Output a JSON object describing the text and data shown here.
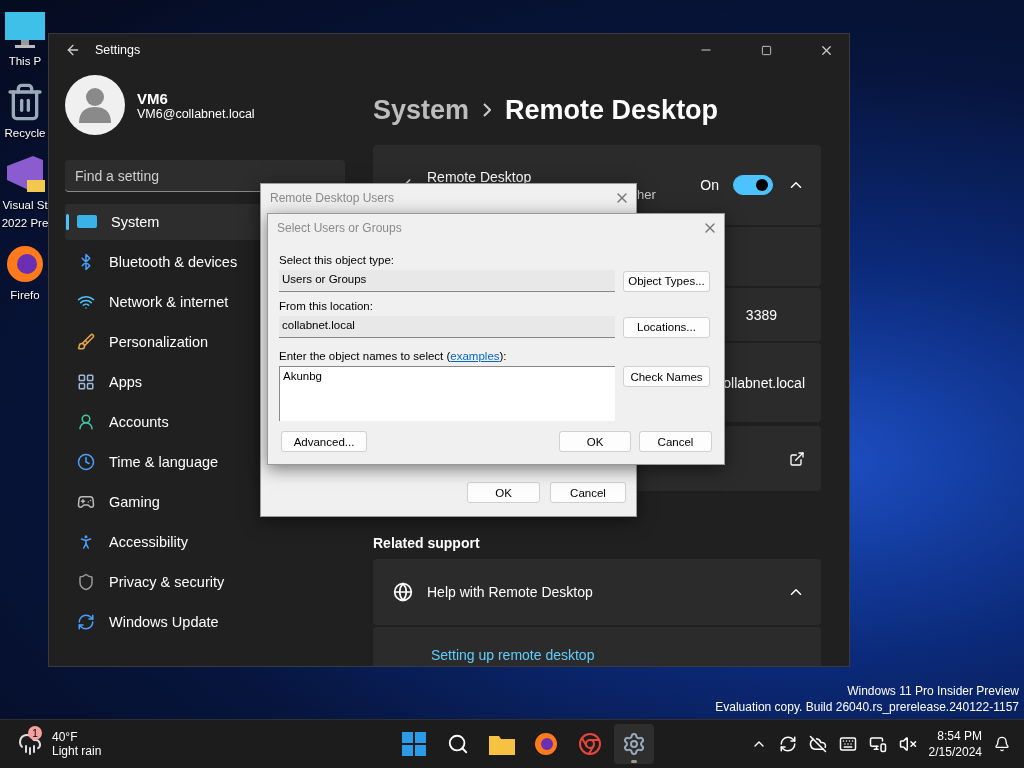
{
  "desktop_icons": [
    {
      "kind": "pc",
      "lines": [
        "This P"
      ]
    },
    {
      "kind": "bin",
      "lines": [
        "Recycle"
      ]
    },
    {
      "kind": "vs",
      "lines": [
        "Visual St",
        "2022 Pre"
      ]
    },
    {
      "kind": "firefox",
      "lines": [
        "Firefo"
      ]
    }
  ],
  "settings": {
    "title": "Settings",
    "user": {
      "name": "VM6",
      "email": "VM6@collabnet.local"
    },
    "search": {
      "placeholder": "Find a setting"
    },
    "nav": [
      {
        "label": "System",
        "selected": true
      },
      {
        "label": "Bluetooth & devices",
        "selected": false
      },
      {
        "label": "Network & internet",
        "selected": false
      },
      {
        "label": "Personalization",
        "selected": false
      },
      {
        "label": "Apps",
        "selected": false
      },
      {
        "label": "Accounts",
        "selected": false
      },
      {
        "label": "Time & language",
        "selected": false
      },
      {
        "label": "Gaming",
        "selected": false
      },
      {
        "label": "Accessibility",
        "selected": false
      },
      {
        "label": "Privacy & security",
        "selected": false
      },
      {
        "label": "Windows Update",
        "selected": false
      }
    ],
    "breadcrumb": [
      "System",
      "Remote Desktop"
    ],
    "remote_desktop": {
      "title": "Remote Desktop",
      "description_fragment": "her",
      "state_label": "On",
      "on": true,
      "expanded": true
    },
    "port": "3389",
    "pc_name_fragment": "ollabnet.local",
    "related_support": {
      "heading": "Related support",
      "help_title": "Help with Remote Desktop",
      "expanded": true,
      "link": "Setting up remote desktop"
    }
  },
  "rdu_dialog": {
    "title": "Remote Desktop Users",
    "ok": "OK",
    "cancel": "Cancel"
  },
  "select_dialog": {
    "title": "Select Users or Groups",
    "object_type": {
      "label": "Select this object type:",
      "value": "Users or Groups",
      "button": "Object Types..."
    },
    "location": {
      "label": "From this location:",
      "value": "collabnet.local",
      "button": "Locations..."
    },
    "names": {
      "label": "Enter the object names to select (",
      "link": "examples",
      "label_end": "):",
      "value": "Akunbg",
      "button": "Check Names"
    },
    "advanced": "Advanced...",
    "ok": "OK",
    "cancel": "Cancel"
  },
  "watermark": [
    "Windows 11 Pro Insider Preview",
    "Evaluation copy. Build 26040.rs_prerelease.240122-1157"
  ],
  "taskbar": {
    "weather": {
      "temp": "40°F",
      "condition": "Light rain",
      "badge": "1"
    },
    "apps": [
      {
        "kind": "start",
        "active": false
      },
      {
        "kind": "search",
        "active": false
      },
      {
        "kind": "files",
        "active": false
      },
      {
        "kind": "firefox",
        "active": false
      },
      {
        "kind": "chrome",
        "active": false
      },
      {
        "kind": "settings",
        "active": true
      }
    ],
    "clock": {
      "time": "8:54 PM",
      "date": "2/15/2024"
    }
  }
}
